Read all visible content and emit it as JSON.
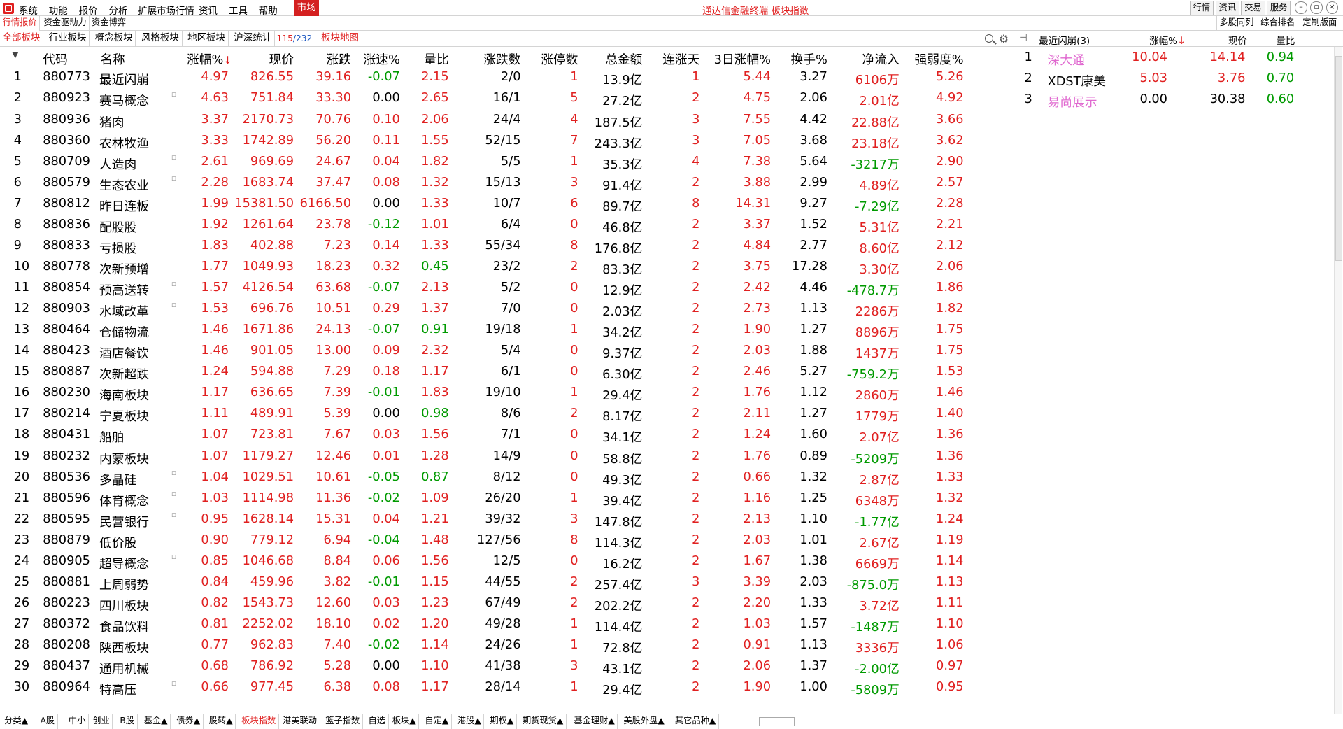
{
  "menubar": {
    "items": [
      "系统",
      "功能",
      "报价",
      "分析",
      "扩展市场行情",
      "资讯",
      "工具",
      "帮助"
    ],
    "market_label": "市场",
    "window_title": "通达信金融终端  板块指数",
    "right_buttons": [
      "行情",
      "资讯",
      "交易",
      "服务"
    ]
  },
  "tabs_top": {
    "items": [
      "行情报价",
      "资金驱动力",
      "资金博弈"
    ],
    "right_links": [
      "多股同列",
      "综合排名",
      "定制版面"
    ]
  },
  "tabs_sector": {
    "items": [
      "全部板块",
      "行业板块",
      "概念板块",
      "风格板块",
      "地区板块",
      "沪深统计"
    ],
    "count_current": "115",
    "count_total": "/232",
    "map_link": "板块地图"
  },
  "table": {
    "headers": [
      "代码",
      "名称",
      "涨幅%",
      "现价",
      "涨跌",
      "涨速%",
      "量比",
      "涨跌数",
      "涨停数",
      "总金额",
      "连涨天",
      "3日涨幅%",
      "换手%",
      "净流入",
      "强弱度%"
    ],
    "sort_arrow": "↓",
    "rows": [
      {
        "idx": "1",
        "code": "880773",
        "name": "最近闪崩",
        "pct": "4.97",
        "price": "826.55",
        "chg": "39.16",
        "speed": "-0.07",
        "vr": "2.15",
        "ud": "2/0",
        "lu": "1",
        "amt": "13.9亿",
        "cd": "1",
        "d3": "5.44",
        "turn": "3.27",
        "flow": "6106万",
        "str": "5.26",
        "mark": ""
      },
      {
        "idx": "2",
        "code": "880923",
        "name": "赛马概念",
        "pct": "4.63",
        "price": "751.84",
        "chg": "33.30",
        "speed": "0.00",
        "vr": "2.65",
        "ud": "16/1",
        "lu": "5",
        "amt": "27.2亿",
        "cd": "2",
        "d3": "4.75",
        "turn": "2.06",
        "flow": "2.01亿",
        "str": "4.92",
        "mark": "▫"
      },
      {
        "idx": "3",
        "code": "880936",
        "name": "猪肉",
        "pct": "3.37",
        "price": "2170.73",
        "chg": "70.76",
        "speed": "0.10",
        "vr": "2.06",
        "ud": "24/4",
        "lu": "4",
        "amt": "187.5亿",
        "cd": "3",
        "d3": "7.55",
        "turn": "4.42",
        "flow": "22.88亿",
        "str": "3.66",
        "mark": ""
      },
      {
        "idx": "4",
        "code": "880360",
        "name": "农林牧渔",
        "pct": "3.33",
        "price": "1742.89",
        "chg": "56.20",
        "speed": "0.11",
        "vr": "1.55",
        "ud": "52/15",
        "lu": "7",
        "amt": "243.3亿",
        "cd": "3",
        "d3": "7.05",
        "turn": "3.68",
        "flow": "23.18亿",
        "str": "3.62",
        "mark": ""
      },
      {
        "idx": "5",
        "code": "880709",
        "name": "人造肉",
        "pct": "2.61",
        "price": "969.69",
        "chg": "24.67",
        "speed": "0.04",
        "vr": "1.82",
        "ud": "5/5",
        "lu": "1",
        "amt": "35.3亿",
        "cd": "4",
        "d3": "7.38",
        "turn": "5.64",
        "flow": "-3217万",
        "str": "2.90",
        "mark": "▫"
      },
      {
        "idx": "6",
        "code": "880579",
        "name": "生态农业",
        "pct": "2.28",
        "price": "1683.74",
        "chg": "37.47",
        "speed": "0.08",
        "vr": "1.32",
        "ud": "15/13",
        "lu": "3",
        "amt": "91.4亿",
        "cd": "2",
        "d3": "3.88",
        "turn": "2.99",
        "flow": "4.89亿",
        "str": "2.57",
        "mark": "▫"
      },
      {
        "idx": "7",
        "code": "880812",
        "name": "昨日连板",
        "pct": "1.99",
        "price": "15381.50",
        "chg": "6166.50",
        "speed": "0.00",
        "vr": "1.33",
        "ud": "10/7",
        "lu": "6",
        "amt": "89.7亿",
        "cd": "8",
        "d3": "14.31",
        "turn": "9.27",
        "flow": "-7.29亿",
        "str": "2.28",
        "mark": ""
      },
      {
        "idx": "8",
        "code": "880836",
        "name": "配股股",
        "pct": "1.92",
        "price": "1261.64",
        "chg": "23.78",
        "speed": "-0.12",
        "vr": "1.01",
        "ud": "6/4",
        "lu": "0",
        "amt": "46.8亿",
        "cd": "2",
        "d3": "3.37",
        "turn": "1.52",
        "flow": "5.31亿",
        "str": "2.21",
        "mark": ""
      },
      {
        "idx": "9",
        "code": "880833",
        "name": "亏损股",
        "pct": "1.83",
        "price": "402.88",
        "chg": "7.23",
        "speed": "0.14",
        "vr": "1.33",
        "ud": "55/34",
        "lu": "8",
        "amt": "176.8亿",
        "cd": "2",
        "d3": "4.84",
        "turn": "2.77",
        "flow": "8.60亿",
        "str": "2.12",
        "mark": ""
      },
      {
        "idx": "10",
        "code": "880778",
        "name": "次新预增",
        "pct": "1.77",
        "price": "1049.93",
        "chg": "18.23",
        "speed": "0.32",
        "vr": "0.45",
        "ud": "23/2",
        "lu": "2",
        "amt": "83.3亿",
        "cd": "2",
        "d3": "3.75",
        "turn": "17.28",
        "flow": "3.30亿",
        "str": "2.06",
        "mark": ""
      },
      {
        "idx": "11",
        "code": "880854",
        "name": "预高送转",
        "pct": "1.57",
        "price": "4126.54",
        "chg": "63.68",
        "speed": "-0.07",
        "vr": "2.13",
        "ud": "5/2",
        "lu": "0",
        "amt": "12.9亿",
        "cd": "2",
        "d3": "2.42",
        "turn": "4.46",
        "flow": "-478.7万",
        "str": "1.86",
        "mark": "▫"
      },
      {
        "idx": "12",
        "code": "880903",
        "name": "水域改革",
        "pct": "1.53",
        "price": "696.76",
        "chg": "10.51",
        "speed": "0.29",
        "vr": "1.37",
        "ud": "7/0",
        "lu": "0",
        "amt": "2.03亿",
        "cd": "2",
        "d3": "2.73",
        "turn": "1.13",
        "flow": "2286万",
        "str": "1.82",
        "mark": "▫"
      },
      {
        "idx": "13",
        "code": "880464",
        "name": "仓储物流",
        "pct": "1.46",
        "price": "1671.86",
        "chg": "24.13",
        "speed": "-0.07",
        "vr": "0.91",
        "ud": "19/18",
        "lu": "1",
        "amt": "34.2亿",
        "cd": "2",
        "d3": "1.90",
        "turn": "1.27",
        "flow": "8896万",
        "str": "1.75",
        "mark": ""
      },
      {
        "idx": "14",
        "code": "880423",
        "name": "酒店餐饮",
        "pct": "1.46",
        "price": "901.05",
        "chg": "13.00",
        "speed": "0.09",
        "vr": "2.32",
        "ud": "5/4",
        "lu": "0",
        "amt": "9.37亿",
        "cd": "2",
        "d3": "2.03",
        "turn": "1.88",
        "flow": "1437万",
        "str": "1.75",
        "mark": ""
      },
      {
        "idx": "15",
        "code": "880887",
        "name": "次新超跌",
        "pct": "1.24",
        "price": "594.88",
        "chg": "7.29",
        "speed": "0.18",
        "vr": "1.17",
        "ud": "6/1",
        "lu": "0",
        "amt": "6.30亿",
        "cd": "2",
        "d3": "2.46",
        "turn": "5.27",
        "flow": "-759.2万",
        "str": "1.53",
        "mark": ""
      },
      {
        "idx": "16",
        "code": "880230",
        "name": "海南板块",
        "pct": "1.17",
        "price": "636.65",
        "chg": "7.39",
        "speed": "-0.01",
        "vr": "1.83",
        "ud": "19/10",
        "lu": "1",
        "amt": "29.4亿",
        "cd": "2",
        "d3": "1.76",
        "turn": "1.12",
        "flow": "2860万",
        "str": "1.46",
        "mark": ""
      },
      {
        "idx": "17",
        "code": "880214",
        "name": "宁夏板块",
        "pct": "1.11",
        "price": "489.91",
        "chg": "5.39",
        "speed": "0.00",
        "vr": "0.98",
        "ud": "8/6",
        "lu": "2",
        "amt": "8.17亿",
        "cd": "2",
        "d3": "2.11",
        "turn": "1.27",
        "flow": "1779万",
        "str": "1.40",
        "mark": ""
      },
      {
        "idx": "18",
        "code": "880431",
        "name": "船舶",
        "pct": "1.07",
        "price": "723.81",
        "chg": "7.67",
        "speed": "0.03",
        "vr": "1.56",
        "ud": "7/1",
        "lu": "0",
        "amt": "34.1亿",
        "cd": "2",
        "d3": "1.24",
        "turn": "1.60",
        "flow": "2.07亿",
        "str": "1.36",
        "mark": ""
      },
      {
        "idx": "19",
        "code": "880232",
        "name": "内蒙板块",
        "pct": "1.07",
        "price": "1179.27",
        "chg": "12.46",
        "speed": "0.01",
        "vr": "1.28",
        "ud": "14/9",
        "lu": "0",
        "amt": "58.8亿",
        "cd": "2",
        "d3": "1.76",
        "turn": "0.89",
        "flow": "-5209万",
        "str": "1.36",
        "mark": ""
      },
      {
        "idx": "20",
        "code": "880536",
        "name": "多晶硅",
        "pct": "1.04",
        "price": "1029.51",
        "chg": "10.61",
        "speed": "-0.05",
        "vr": "0.87",
        "ud": "8/12",
        "lu": "0",
        "amt": "49.3亿",
        "cd": "2",
        "d3": "0.66",
        "turn": "1.32",
        "flow": "2.87亿",
        "str": "1.33",
        "mark": "▫"
      },
      {
        "idx": "21",
        "code": "880596",
        "name": "体育概念",
        "pct": "1.03",
        "price": "1114.98",
        "chg": "11.36",
        "speed": "-0.02",
        "vr": "1.09",
        "ud": "26/20",
        "lu": "1",
        "amt": "39.4亿",
        "cd": "2",
        "d3": "1.16",
        "turn": "1.25",
        "flow": "6348万",
        "str": "1.32",
        "mark": "▫"
      },
      {
        "idx": "22",
        "code": "880595",
        "name": "民营银行",
        "pct": "0.95",
        "price": "1628.14",
        "chg": "15.31",
        "speed": "0.04",
        "vr": "1.21",
        "ud": "39/32",
        "lu": "3",
        "amt": "147.8亿",
        "cd": "2",
        "d3": "2.13",
        "turn": "1.10",
        "flow": "-1.77亿",
        "str": "1.24",
        "mark": "▫"
      },
      {
        "idx": "23",
        "code": "880879",
        "name": "低价股",
        "pct": "0.90",
        "price": "779.12",
        "chg": "6.94",
        "speed": "-0.04",
        "vr": "1.48",
        "ud": "127/56",
        "lu": "8",
        "amt": "114.3亿",
        "cd": "2",
        "d3": "2.03",
        "turn": "1.01",
        "flow": "2.67亿",
        "str": "1.19",
        "mark": ""
      },
      {
        "idx": "24",
        "code": "880905",
        "name": "超导概念",
        "pct": "0.85",
        "price": "1046.68",
        "chg": "8.84",
        "speed": "0.06",
        "vr": "1.56",
        "ud": "12/5",
        "lu": "0",
        "amt": "16.2亿",
        "cd": "2",
        "d3": "1.67",
        "turn": "1.38",
        "flow": "6669万",
        "str": "1.14",
        "mark": "▫"
      },
      {
        "idx": "25",
        "code": "880881",
        "name": "上周弱势",
        "pct": "0.84",
        "price": "459.96",
        "chg": "3.82",
        "speed": "-0.01",
        "vr": "1.15",
        "ud": "44/55",
        "lu": "2",
        "amt": "257.4亿",
        "cd": "3",
        "d3": "3.39",
        "turn": "2.03",
        "flow": "-875.0万",
        "str": "1.13",
        "mark": ""
      },
      {
        "idx": "26",
        "code": "880223",
        "name": "四川板块",
        "pct": "0.82",
        "price": "1543.73",
        "chg": "12.60",
        "speed": "0.03",
        "vr": "1.23",
        "ud": "67/49",
        "lu": "2",
        "amt": "202.2亿",
        "cd": "2",
        "d3": "2.20",
        "turn": "1.33",
        "flow": "3.72亿",
        "str": "1.11",
        "mark": ""
      },
      {
        "idx": "27",
        "code": "880372",
        "name": "食品饮料",
        "pct": "0.81",
        "price": "2252.02",
        "chg": "18.10",
        "speed": "0.02",
        "vr": "1.20",
        "ud": "49/28",
        "lu": "1",
        "amt": "114.4亿",
        "cd": "2",
        "d3": "1.03",
        "turn": "1.57",
        "flow": "-1487万",
        "str": "1.10",
        "mark": ""
      },
      {
        "idx": "28",
        "code": "880208",
        "name": "陕西板块",
        "pct": "0.77",
        "price": "962.83",
        "chg": "7.40",
        "speed": "-0.02",
        "vr": "1.14",
        "ud": "24/26",
        "lu": "1",
        "amt": "72.8亿",
        "cd": "2",
        "d3": "0.91",
        "turn": "1.13",
        "flow": "3336万",
        "str": "1.06",
        "mark": ""
      },
      {
        "idx": "29",
        "code": "880437",
        "name": "通用机械",
        "pct": "0.68",
        "price": "786.92",
        "chg": "5.28",
        "speed": "0.00",
        "vr": "1.10",
        "ud": "41/38",
        "lu": "3",
        "amt": "43.1亿",
        "cd": "2",
        "d3": "2.06",
        "turn": "1.37",
        "flow": "-2.00亿",
        "str": "0.97",
        "mark": ""
      },
      {
        "idx": "30",
        "code": "880964",
        "name": "特高压",
        "pct": "0.66",
        "price": "977.45",
        "chg": "6.38",
        "speed": "0.08",
        "vr": "1.17",
        "ud": "28/14",
        "lu": "1",
        "amt": "29.4亿",
        "cd": "2",
        "d3": "1.90",
        "turn": "1.00",
        "flow": "-5809万",
        "str": "0.95",
        "mark": "▫"
      }
    ]
  },
  "right_panel": {
    "title": "最近闪崩(3)",
    "headers": [
      "涨幅%",
      "现价",
      "量比"
    ],
    "rows": [
      {
        "idx": "1",
        "name": "深大通",
        "pct": "10.04",
        "price": "14.14",
        "vr": "0.94"
      },
      {
        "idx": "2",
        "name": "XDST康美",
        "pct": "5.03",
        "price": "3.76",
        "vr": "0.70"
      },
      {
        "idx": "3",
        "name": "易尚展示",
        "pct": "0.00",
        "price": "30.38",
        "vr": "0.60"
      }
    ]
  },
  "bottom_tabs": [
    "分类▲",
    "A股",
    "中小",
    "创业",
    "B股",
    "基金▲",
    "债券▲",
    "股转▲",
    "板块指数",
    "港美联动",
    "篮子指数",
    "自选",
    "板块▲",
    "自定▲",
    "港股▲",
    "期权▲",
    "期货现货▲",
    "基金理财▲",
    "美股外盘▲",
    "其它品种▲"
  ],
  "colors": {
    "up": "#e02020",
    "down": "#009a00",
    "accent": "#1a56c0",
    "pink": "#e06ad0"
  }
}
